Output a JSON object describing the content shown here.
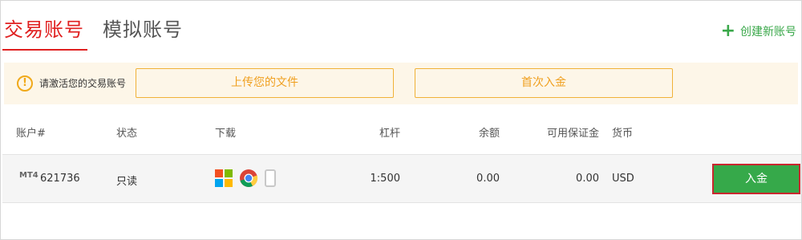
{
  "tabs": {
    "active_label": "交易账号",
    "inactive_label": "模拟账号"
  },
  "create_account_label": "创建新账号",
  "notice": {
    "text": "请激活您的交易账号",
    "upload_button": "上传您的文件",
    "deposit_button": "首次入金"
  },
  "table": {
    "headers": {
      "account": "账户#",
      "status": "状态",
      "download": "下载",
      "leverage": "杠杆",
      "balance": "余额",
      "free_margin": "可用保证金",
      "currency": "货币"
    },
    "rows": [
      {
        "platform_badge": "MT4",
        "account": "621736",
        "status": "只读",
        "download_icons": [
          "windows-icon",
          "chrome-icon",
          "mobile-icon"
        ],
        "leverage": "1:500",
        "balance": "0.00",
        "free_margin": "0.00",
        "currency": "USD",
        "action_label": "入金"
      }
    ]
  },
  "colors": {
    "accent_red": "#e02020",
    "green": "#36a94a",
    "warning_orange": "#f0a91a",
    "notice_bg": "#fdf6e8"
  }
}
